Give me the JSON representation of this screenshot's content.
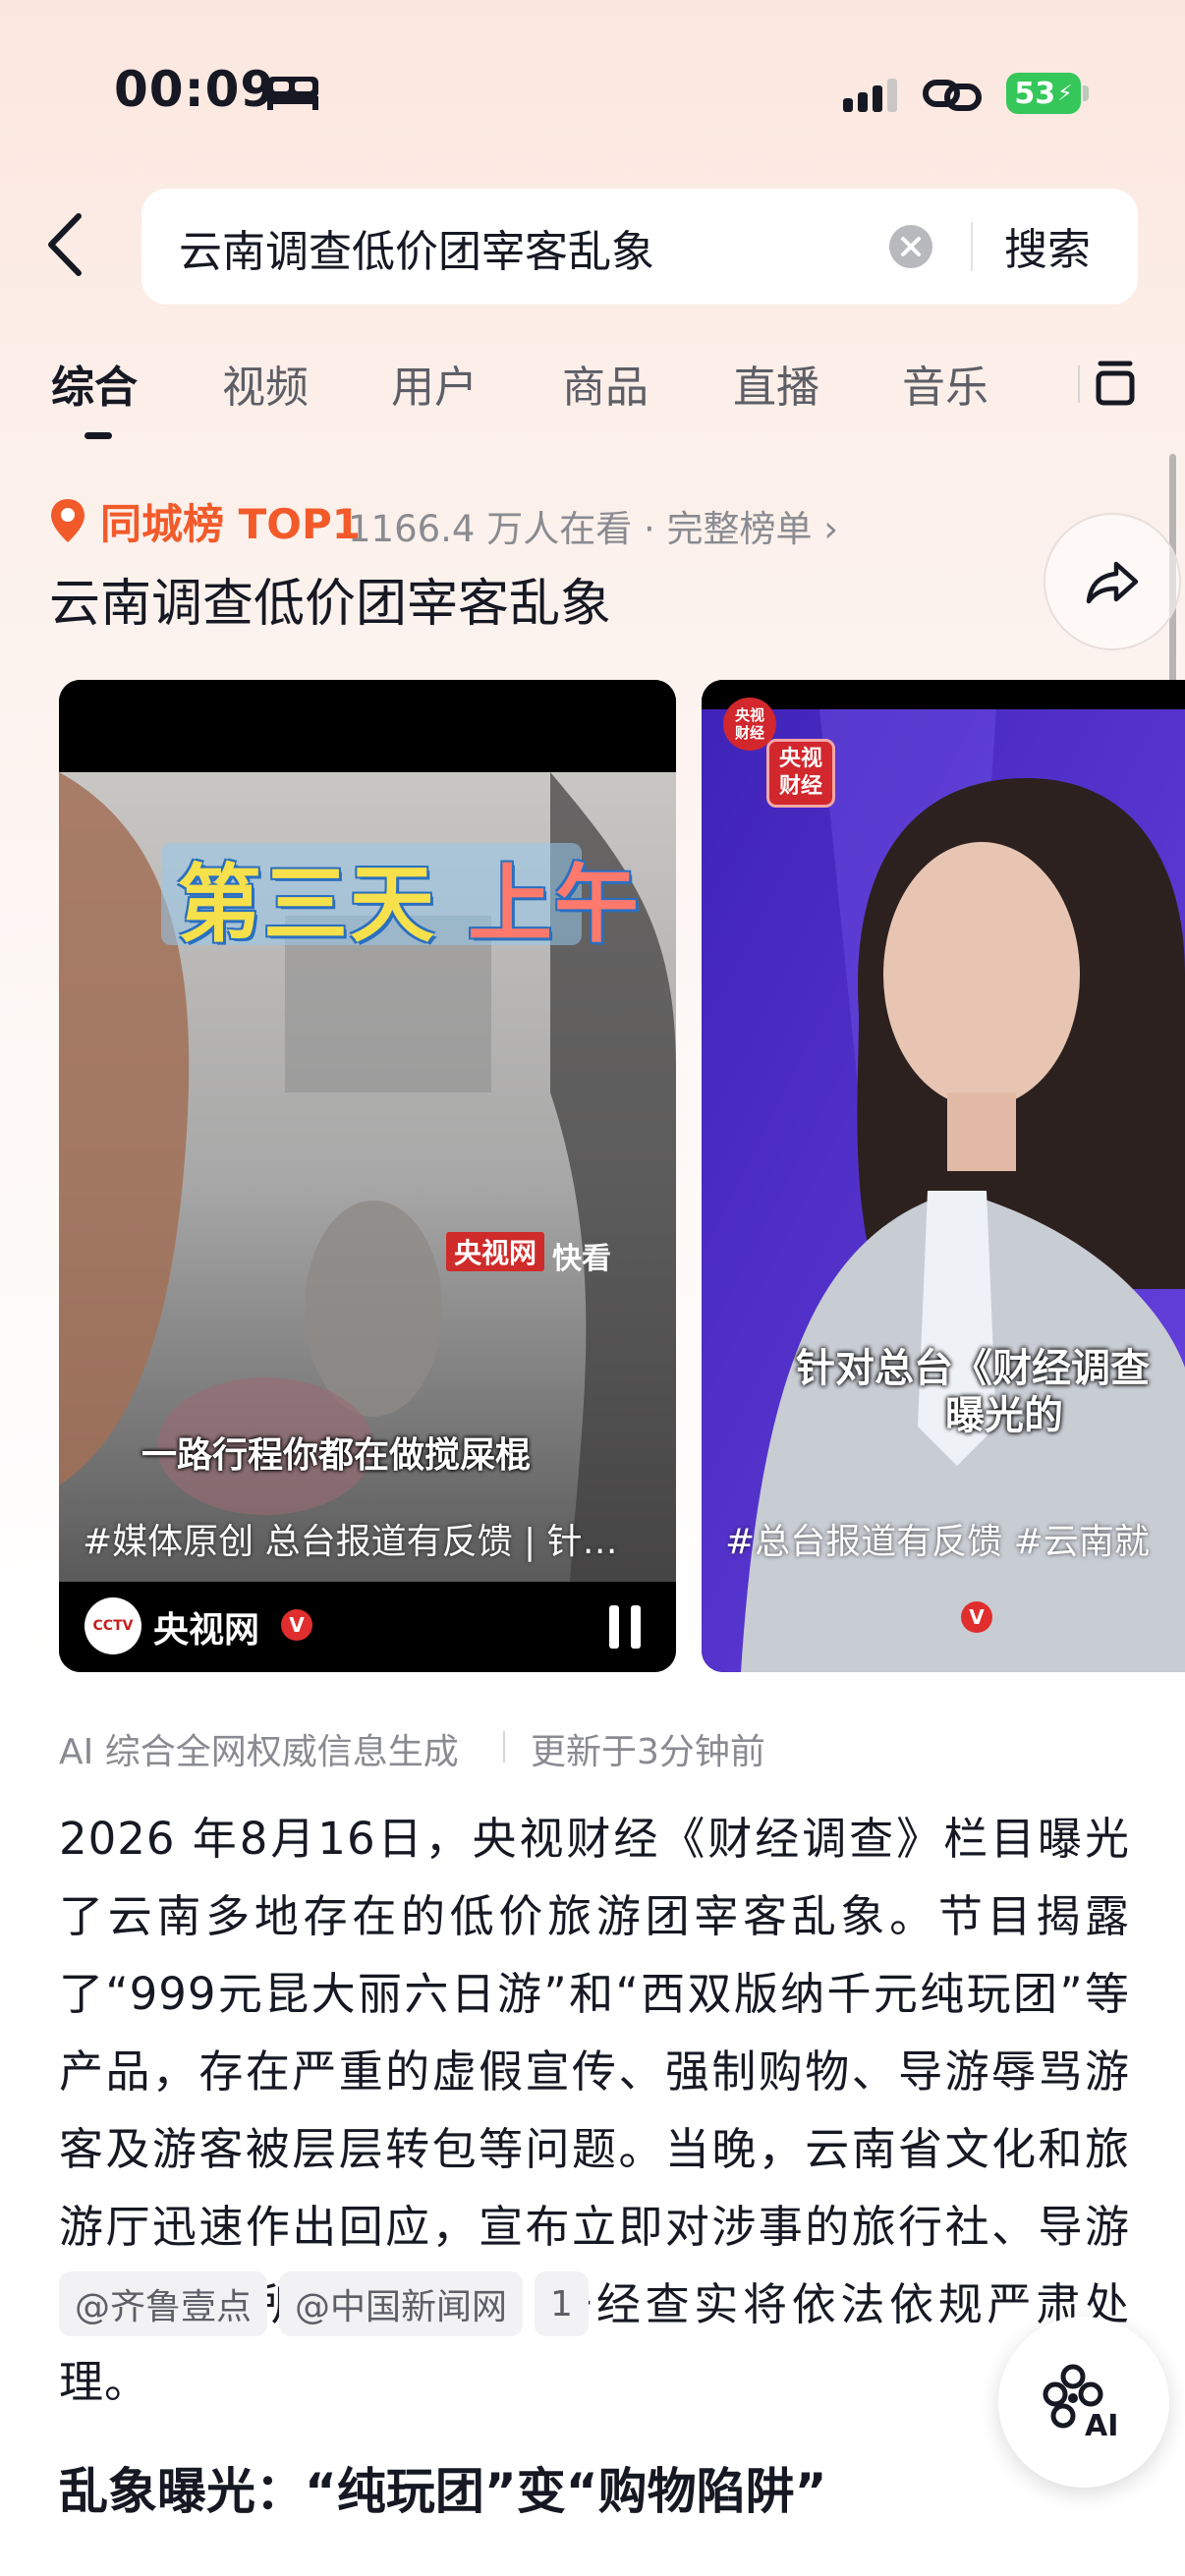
{
  "status_bar": {
    "time": "00:09",
    "battery": "53"
  },
  "search": {
    "query": "云南调查低价团宰客乱象",
    "button_label": "搜索"
  },
  "tabs": [
    {
      "label": "综合",
      "active": true
    },
    {
      "label": "视频",
      "active": false
    },
    {
      "label": "用户",
      "active": false
    },
    {
      "label": "商品",
      "active": false
    },
    {
      "label": "直播",
      "active": false
    },
    {
      "label": "音乐",
      "active": false
    }
  ],
  "hot": {
    "label": "同城榜 TOP1",
    "meta": "1166.4 万人在看 · 完整榜单 ›",
    "title": "云南调查低价团宰客乱象"
  },
  "videos": [
    {
      "overlay_title_a": "第三天 ",
      "overlay_title_b": "上午",
      "watermark_box": "央视网",
      "watermark_text": "快看",
      "caption": "一路行程你都在做搅屎棍",
      "tags": "#媒体原创 总台报道有反馈 | 针…",
      "avatar_text": "CCTV",
      "author": "央视网",
      "verified_mark": "V"
    },
    {
      "badge_line1": "央视",
      "badge_line2": "财经",
      "caption_line1": "针对总台《财经调查",
      "caption_line2": "曝光的",
      "tags": "#总台报道有反馈  #云南就",
      "verified_mark": "V"
    }
  ],
  "ai_summary": {
    "source_note": "AI 综合全网权威信息生成",
    "updated": "更新于3分钟前",
    "text": "2026 年8月16日，央视财经《财经调查》栏目曝光了云南多地存在的低价旅游团宰客乱象。节目揭露了“999元昆大丽六日游”和“西双版纳千元纯玩团”等产品，存在严重的虚假宣传、强制购物、导游辱骂游客及游客被层层转包等问题。当晚，云南省文化和旅游厅迅速作出回应，宣布立即对涉事的旅行社、导游及购物场所展开调查，一经查实将依法依规严肃处理。",
    "sources": [
      "@齐鲁壹点",
      "@中国新闻网",
      "1"
    ]
  },
  "section": {
    "heading": "乱象曝光：“纯玩团”变“购物陷阱”"
  },
  "fab": {
    "label": "AI"
  },
  "colors": {
    "accent_orange": "#f25a2a",
    "verified_red": "#e02e2e",
    "battery_green": "#35c759"
  },
  "icons": [
    "bed-icon",
    "signal-icon",
    "link-icon",
    "back-icon",
    "clear-icon",
    "tab-more-icon",
    "location-pin-icon",
    "share-icon",
    "pause-icon",
    "ai-icon"
  ]
}
